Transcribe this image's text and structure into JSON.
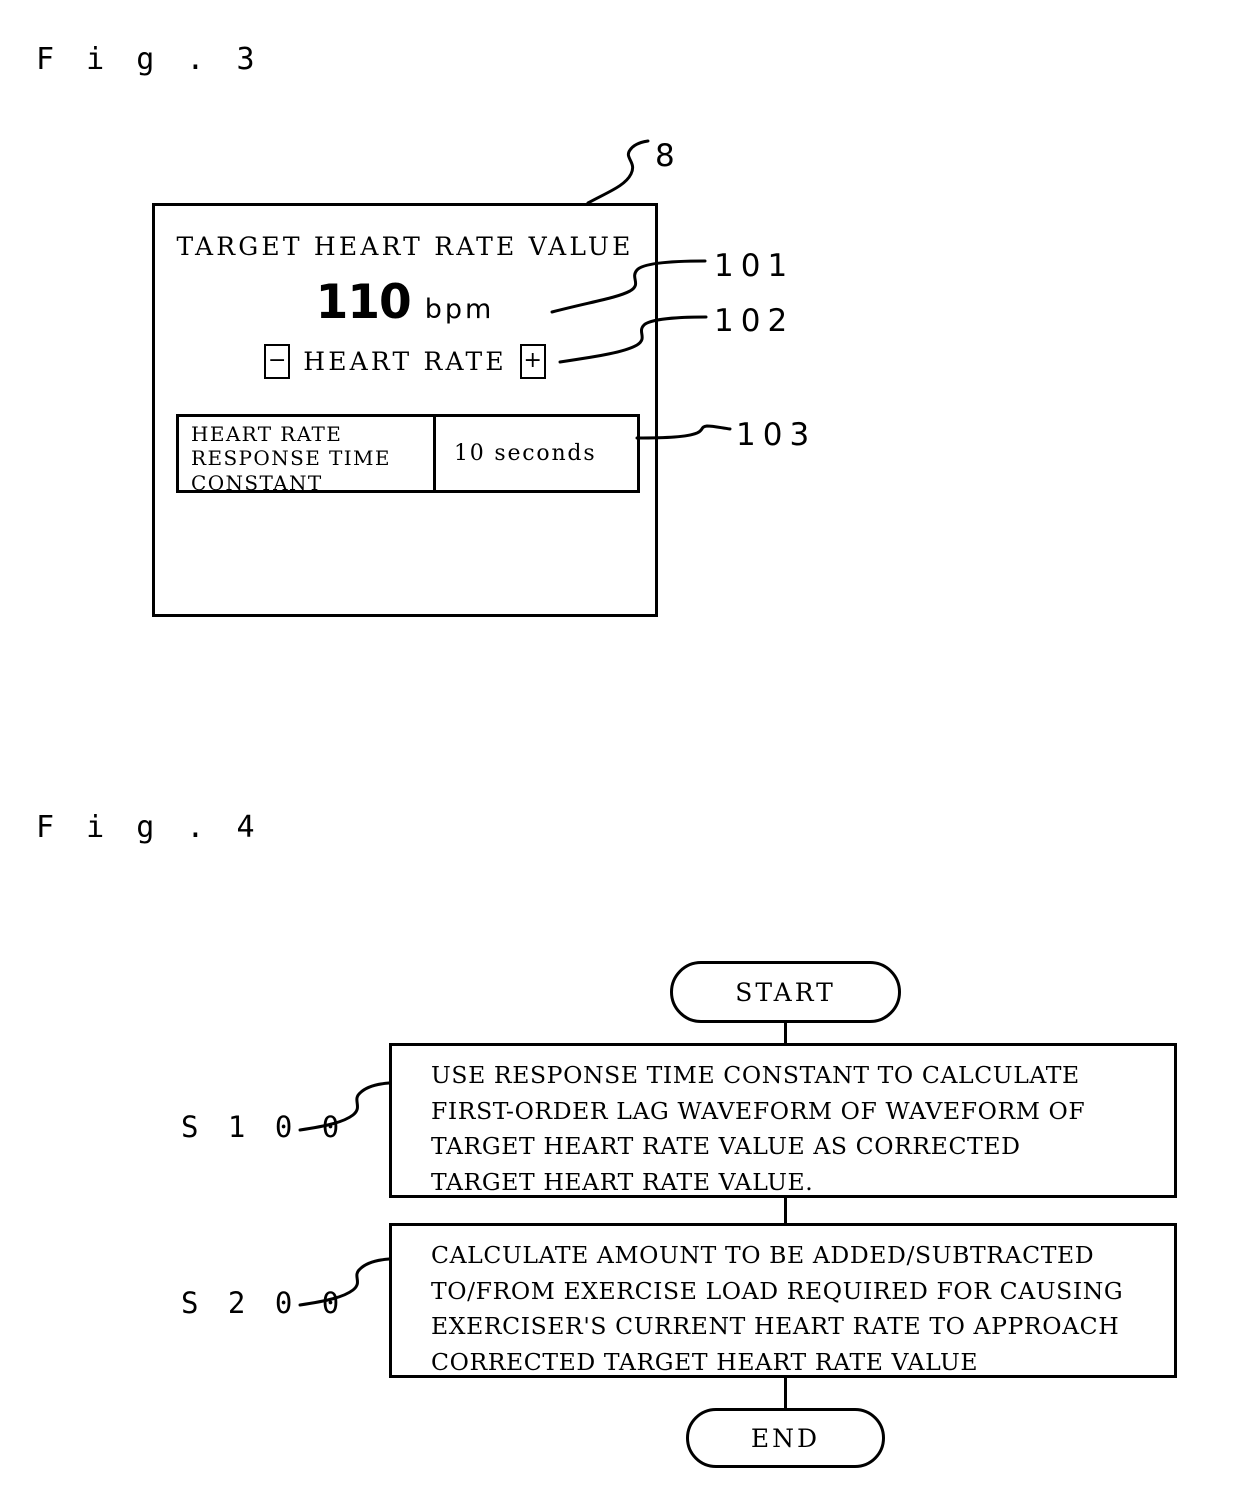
{
  "figures": {
    "fig3": {
      "label": "F i g .  3",
      "panel": {
        "ref": "8",
        "title": "TARGET HEART RATE VALUE",
        "target_value": "110",
        "value_unit": "bpm",
        "value_ref": "101",
        "decrease_button": "−",
        "increase_button": "+",
        "adjust_label": "HEART RATE",
        "adjust_ref": "102",
        "table": {
          "row_label": "HEART RATE\nRESPONSE TIME\nCONSTANT",
          "row_value": "10 seconds",
          "ref": "103"
        }
      }
    },
    "fig4": {
      "label": "F i g .  4",
      "flow": {
        "start": "START",
        "end": "END",
        "steps": [
          {
            "id": "S 1 0 0",
            "text": "USE RESPONSE TIME CONSTANT TO CALCULATE\nFIRST-ORDER LAG WAVEFORM OF WAVEFORM OF\nTARGET HEART RATE VALUE AS CORRECTED\nTARGET HEART RATE VALUE."
          },
          {
            "id": "S 2 0 0",
            "text": "CALCULATE AMOUNT TO BE ADDED/SUBTRACTED\nTO/FROM EXERCISE LOAD REQUIRED FOR CAUSING\nEXERCISER'S CURRENT HEART RATE TO APPROACH\nCORRECTED TARGET HEART RATE VALUE"
          }
        ]
      }
    }
  },
  "colors": {
    "ink": "#000000",
    "paper": "#ffffff"
  }
}
